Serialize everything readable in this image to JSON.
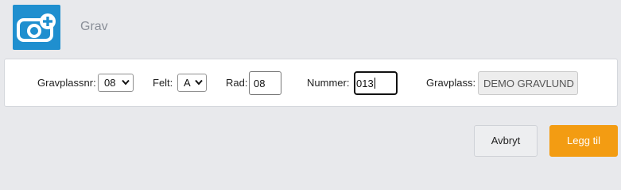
{
  "header": {
    "title": "Grav",
    "app_icon": "camera-plus-icon",
    "accent": "#1f8fcf"
  },
  "form": {
    "gravplassnr": {
      "label": "Gravplassnr:",
      "value": "08"
    },
    "felt": {
      "label": "Felt:",
      "value": "A"
    },
    "rad": {
      "label": "Rad:",
      "value": "08"
    },
    "nummer": {
      "label": "Nummer:",
      "value": "013"
    },
    "gravplass": {
      "label": "Gravplass:",
      "value": "DEMO GRAVLUND"
    }
  },
  "actions": {
    "cancel_label": "Avbryt",
    "add_label": "Legg til",
    "add_color": "#f39c12"
  }
}
